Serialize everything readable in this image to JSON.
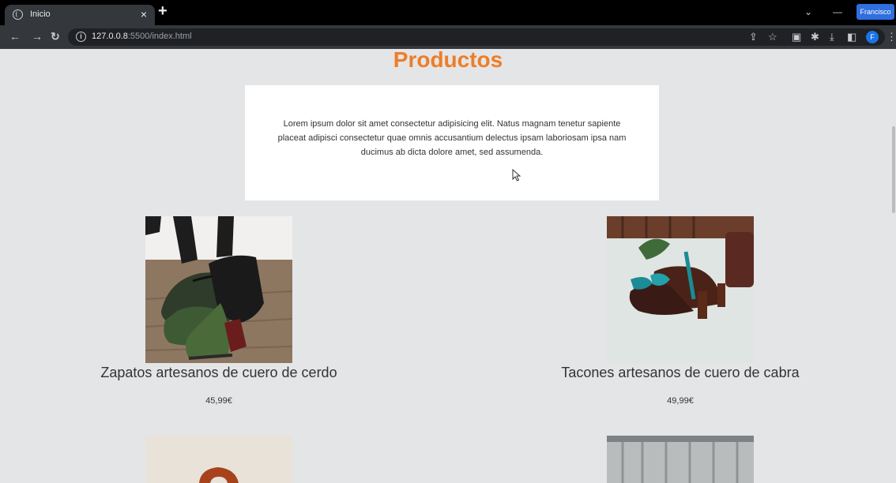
{
  "browser": {
    "tab_title": "Inicio",
    "tab_close": "×",
    "new_tab": "+",
    "profile_name": "Francisco",
    "profile_initial": "F",
    "url_host": "127.0.0.8",
    "url_rest": ":5500/index.html",
    "info_glyph": "i"
  },
  "page": {
    "title": "Productos",
    "intro": "Lorem ipsum dolor sit amet consectetur adipisicing elit. Natus magnam tenetur sapiente placeat adipisci consectetur quae omnis accusantium delectus ipsam laboriosam ipsa nam ducimus ab dicta dolore amet, sed assumenda."
  },
  "products": [
    {
      "name": "Zapatos artesanos de cuero de cerdo",
      "price": "45,99€"
    },
    {
      "name": "Tacones artesanos de cuero de cabra",
      "price": "49,99€"
    }
  ],
  "colors": {
    "title": "#ee7d27",
    "background": "#e4e5e7",
    "card": "#ffffff"
  }
}
